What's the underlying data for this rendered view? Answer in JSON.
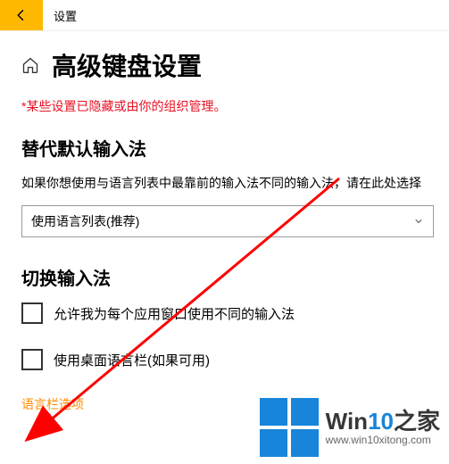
{
  "titlebar": {
    "title": "设置"
  },
  "page": {
    "heading": "高级键盘设置",
    "warning": "*某些设置已隐藏或由你的组织管理。"
  },
  "override": {
    "heading": "替代默认输入法",
    "desc": "如果你想使用与语言列表中最靠前的输入法不同的输入法，请在此处选择",
    "dropdown_value": "使用语言列表(推荐)"
  },
  "switch": {
    "heading": "切换输入法",
    "cb1_label": "允许我为每个应用窗口使用不同的输入法",
    "cb2_label": "使用桌面语言栏(如果可用)",
    "link": "语言栏选项"
  },
  "watermark": {
    "brand_a": "Win",
    "brand_b": "10",
    "brand_c": "之家",
    "url": "www.win10xitong.com"
  }
}
